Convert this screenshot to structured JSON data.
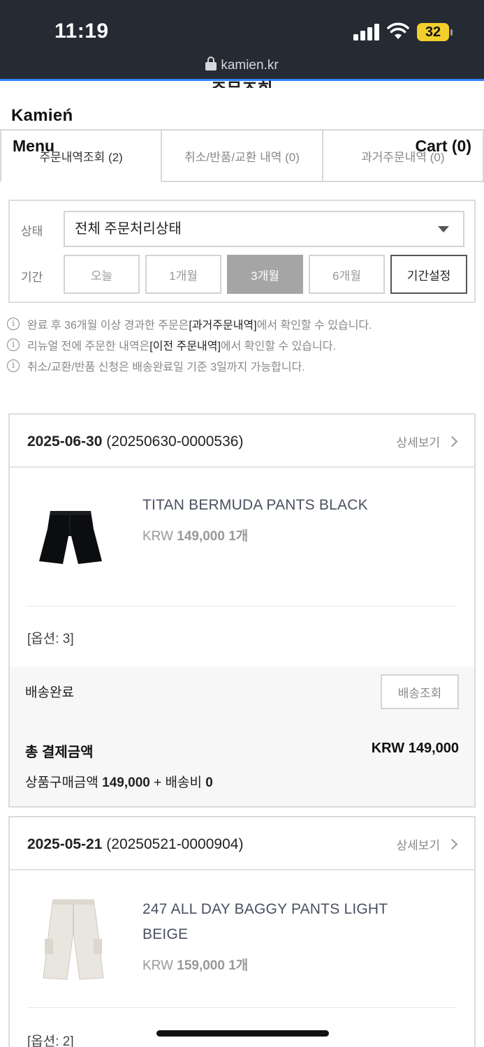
{
  "status_bar": {
    "time": "11:19",
    "battery": "32",
    "url": "kamien.kr"
  },
  "page": {
    "title": "주문조회",
    "brand": "Kamień"
  },
  "nav": {
    "menu": "Menu",
    "cart": "Cart (0)"
  },
  "tabs": [
    {
      "label": "주문내역조회 (2)"
    },
    {
      "label": "취소/반품/교환 내역 (0)"
    },
    {
      "label": "과거주문내역 (0)"
    }
  ],
  "filter": {
    "status_label": "상태",
    "status_value": "전체 주문처리상태",
    "period_label": "기간",
    "periods": [
      "오늘",
      "1개월",
      "3개월",
      "6개월"
    ],
    "custom_period": "기간설정",
    "active_period": "3개월"
  },
  "notices": [
    {
      "pre": "완료 후 36개월 이상 경과한 주문은 ",
      "link": "[과거주문내역]",
      "post": "에서 확인할 수 있습니다."
    },
    {
      "pre": "리뉴얼 전에 주문한 내역은 ",
      "link": "[이전 주문내역]",
      "post": "에서 확인할 수 있습니다."
    },
    {
      "pre": "취소/교환/반품 신청은 배송완료일 기준 3일까지 가능합니다.",
      "link": "",
      "post": ""
    }
  ],
  "orders": [
    {
      "date": "2025-06-30",
      "order_no": "(20250630-0000536)",
      "detail_label": "상세보기",
      "product_name": "TITAN BERMUDA PANTS BLACK",
      "currency": "KRW",
      "price": "149,000",
      "qty": "1개",
      "option": "[옵션: 3]",
      "ship_status": "배송완료",
      "track_label": "배송조회",
      "total_label": "총 결제금액",
      "total_value": "KRW 149,000",
      "goods_label": "상품구매금액",
      "goods_amount": "149,000",
      "ship_fee_label": "+ 배송비",
      "ship_fee": "0"
    },
    {
      "date": "2025-05-21",
      "order_no": "(20250521-0000904)",
      "detail_label": "상세보기",
      "product_name_line1": "247 ALL DAY BAGGY PANTS LIGHT",
      "product_name_line2": "BEIGE",
      "currency": "KRW",
      "price": "159,000",
      "qty": "1개",
      "option": "[옵션: 2]"
    }
  ]
}
